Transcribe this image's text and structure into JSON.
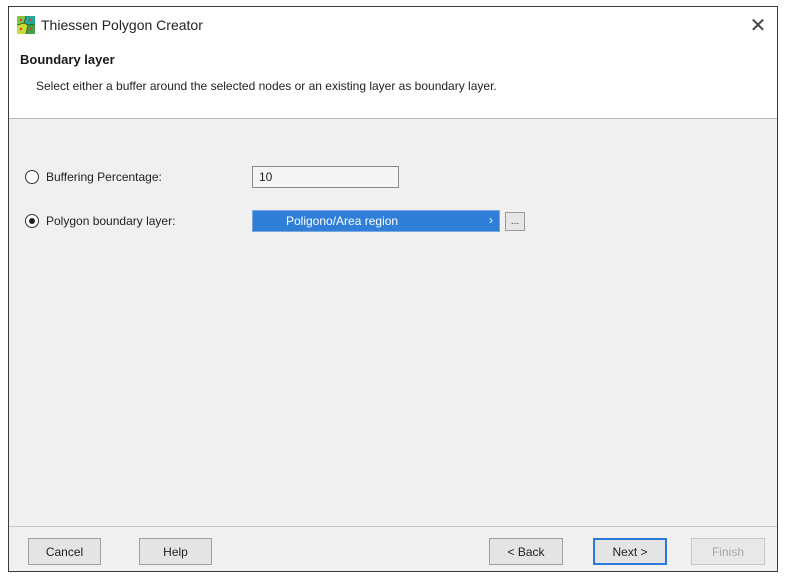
{
  "window": {
    "title": "Thiessen Polygon Creator",
    "close_symbol": "✕"
  },
  "header": {
    "title": "Boundary layer",
    "description": "Select either a buffer around the selected nodes or an existing layer as boundary layer."
  },
  "options": {
    "buffering": {
      "label": "Buffering Percentage:",
      "value": "10",
      "selected": false
    },
    "polygon_layer": {
      "label": "Polygon boundary layer:",
      "value": "Poligono/Area region",
      "selected": true,
      "browse_label": "..."
    }
  },
  "buttons": {
    "cancel": "Cancel",
    "help": "Help",
    "back": "< Back",
    "next": "Next >",
    "finish": "Finish"
  },
  "colors": {
    "selection": "#2f7fd9",
    "default_button_border": "#2a78d8"
  },
  "icons": {
    "app": "thiessen-polygon-icon",
    "close": "close-icon",
    "dropdown": "chevron-down-icon"
  }
}
